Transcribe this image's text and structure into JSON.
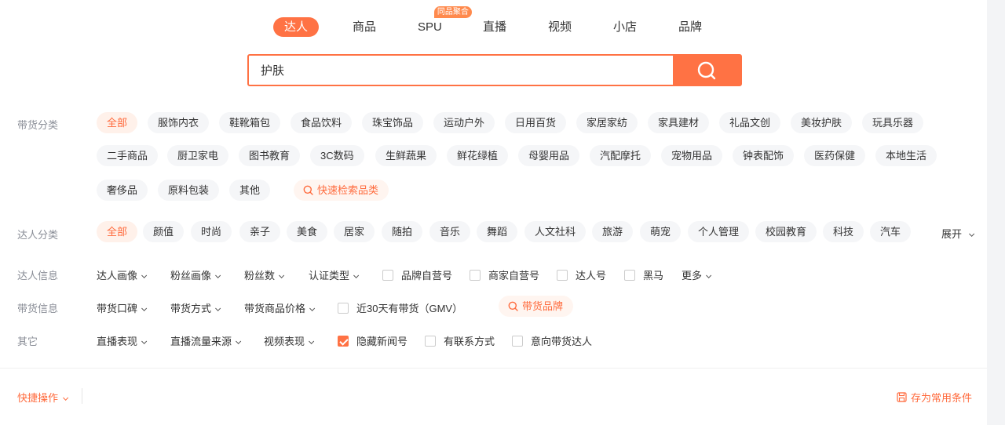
{
  "tabs": [
    {
      "label": "达人",
      "active": true
    },
    {
      "label": "商品"
    },
    {
      "label": "SPU",
      "badge": "同品聚合"
    },
    {
      "label": "直播"
    },
    {
      "label": "视频"
    },
    {
      "label": "小店"
    },
    {
      "label": "品牌"
    }
  ],
  "search": {
    "value": "护肤"
  },
  "categories": {
    "label": "带货分类",
    "items": [
      "全部",
      "服饰内衣",
      "鞋靴箱包",
      "食品饮料",
      "珠宝饰品",
      "运动户外",
      "日用百货",
      "家居家纺",
      "家具建材",
      "礼品文创",
      "美妆护肤",
      "玩具乐器",
      "二手商品",
      "厨卫家电",
      "图书教育",
      "3C数码",
      "生鲜蔬果",
      "鲜花绿植",
      "母婴用品",
      "汽配摩托",
      "宠物用品",
      "钟表配饰",
      "医药保健",
      "本地生活",
      "奢侈品",
      "原料包装",
      "其他"
    ],
    "quick_search": "快速检索品类"
  },
  "talent_categories": {
    "label": "达人分类",
    "items": [
      "全部",
      "颜值",
      "时尚",
      "亲子",
      "美食",
      "居家",
      "随拍",
      "音乐",
      "舞蹈",
      "人文社科",
      "旅游",
      "萌宠",
      "个人管理",
      "校园教育",
      "科技",
      "汽车"
    ],
    "expand": "展开"
  },
  "talent_info": {
    "label": "达人信息",
    "dropdowns": [
      "达人画像",
      "粉丝画像",
      "粉丝数",
      "认证类型"
    ],
    "checkboxes": [
      "品牌自营号",
      "商家自营号",
      "达人号",
      "黑马"
    ],
    "more": "更多"
  },
  "sales_info": {
    "label": "带货信息",
    "dropdowns": [
      "带货口碑",
      "带货方式",
      "带货商品价格"
    ],
    "checkbox": "近30天有带货（GMV）",
    "brand_button": "带货品牌"
  },
  "other": {
    "label": "其它",
    "dropdowns": [
      "直播表现",
      "直播流量来源",
      "视频表现"
    ],
    "checkboxes": [
      {
        "label": "隐藏新闻号",
        "checked": true
      },
      {
        "label": "有联系方式",
        "checked": false
      },
      {
        "label": "意向带货达人",
        "checked": false
      }
    ]
  },
  "footer": {
    "quick_ops": "快捷操作",
    "save": "存为常用条件"
  },
  "colors": {
    "accent": "#ff7244",
    "accent_text": "#ff6a3c",
    "chip_bg": "#f5f6f8"
  }
}
